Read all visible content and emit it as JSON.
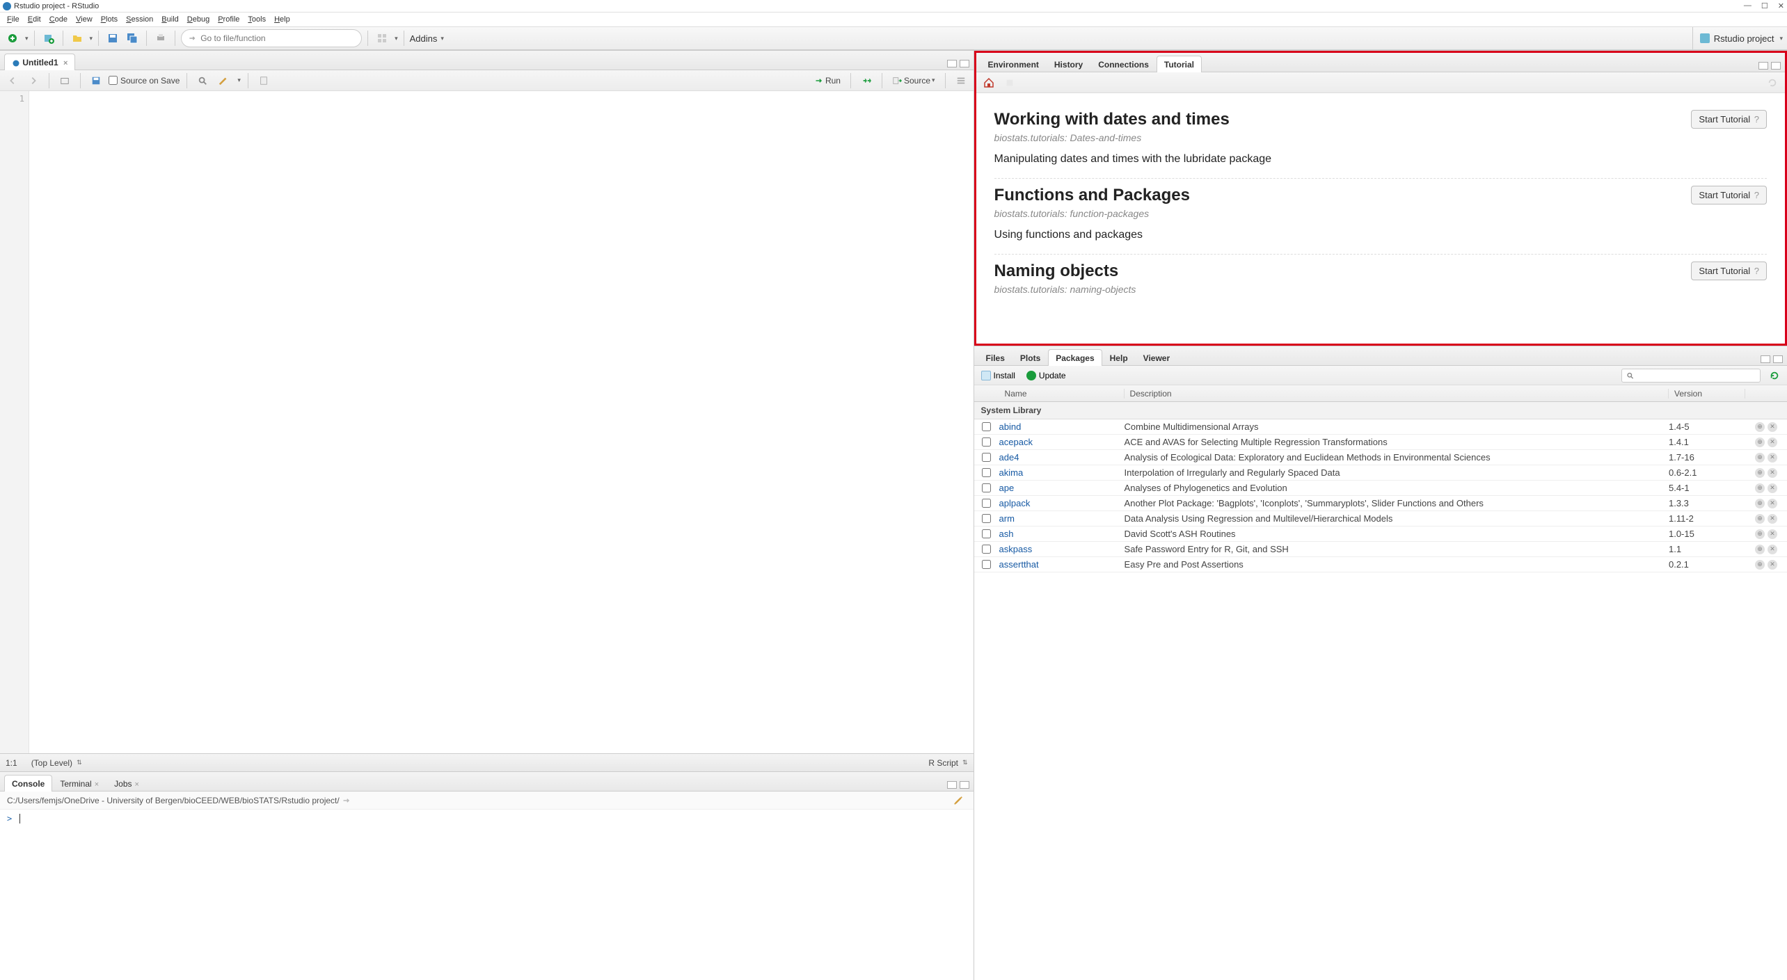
{
  "window": {
    "title": "Rstudio project - RStudio"
  },
  "menu": {
    "file": "File",
    "edit": "Edit",
    "code": "Code",
    "view": "View",
    "plots": "Plots",
    "session": "Session",
    "build": "Build",
    "debug": "Debug",
    "profile": "Profile",
    "tools": "Tools",
    "help": "Help"
  },
  "toolbar": {
    "goto_placeholder": "Go to file/function",
    "addins": "Addins",
    "project": "Rstudio project"
  },
  "source": {
    "tab_name": "Untitled1",
    "save_on_source": "Source on Save",
    "run": "Run",
    "source_btn": "Source",
    "line": "1",
    "pos": "1:1",
    "scope": "(Top Level)",
    "lang": "R Script"
  },
  "console": {
    "tabs": {
      "console": "Console",
      "terminal": "Terminal",
      "jobs": "Jobs"
    },
    "path": "C:/Users/femjs/OneDrive - University of Bergen/bioCEED/WEB/bioSTATS/Rstudio project/",
    "prompt": ">"
  },
  "topright": {
    "tabs": {
      "env": "Environment",
      "hist": "History",
      "conn": "Connections",
      "tut": "Tutorial"
    },
    "tutorials": [
      {
        "title": "Working with dates and times",
        "meta": "biostats.tutorials: Dates-and-times",
        "desc": "Manipulating dates and times with the lubridate package"
      },
      {
        "title": "Functions and Packages",
        "meta": "biostats.tutorials: function-packages",
        "desc": "Using functions and packages"
      },
      {
        "title": "Naming objects",
        "meta": "biostats.tutorials: naming-objects",
        "desc": ""
      }
    ],
    "start_label": "Start Tutorial"
  },
  "bottomright": {
    "tabs": {
      "files": "Files",
      "plots": "Plots",
      "packages": "Packages",
      "help": "Help",
      "viewer": "Viewer"
    },
    "install": "Install",
    "update": "Update",
    "cols": {
      "name": "Name",
      "desc": "Description",
      "ver": "Version"
    },
    "group": "System Library",
    "packages": [
      {
        "name": "abind",
        "desc": "Combine Multidimensional Arrays",
        "ver": "1.4-5"
      },
      {
        "name": "acepack",
        "desc": "ACE and AVAS for Selecting Multiple Regression Transformations",
        "ver": "1.4.1"
      },
      {
        "name": "ade4",
        "desc": "Analysis of Ecological Data: Exploratory and Euclidean Methods in Environmental Sciences",
        "ver": "1.7-16"
      },
      {
        "name": "akima",
        "desc": "Interpolation of Irregularly and Regularly Spaced Data",
        "ver": "0.6-2.1"
      },
      {
        "name": "ape",
        "desc": "Analyses of Phylogenetics and Evolution",
        "ver": "5.4-1"
      },
      {
        "name": "aplpack",
        "desc": "Another Plot Package: 'Bagplots', 'Iconplots', 'Summaryplots', Slider Functions and Others",
        "ver": "1.3.3"
      },
      {
        "name": "arm",
        "desc": "Data Analysis Using Regression and Multilevel/Hierarchical Models",
        "ver": "1.11-2"
      },
      {
        "name": "ash",
        "desc": "David Scott's ASH Routines",
        "ver": "1.0-15"
      },
      {
        "name": "askpass",
        "desc": "Safe Password Entry for R, Git, and SSH",
        "ver": "1.1"
      },
      {
        "name": "assertthat",
        "desc": "Easy Pre and Post Assertions",
        "ver": "0.2.1"
      }
    ]
  }
}
